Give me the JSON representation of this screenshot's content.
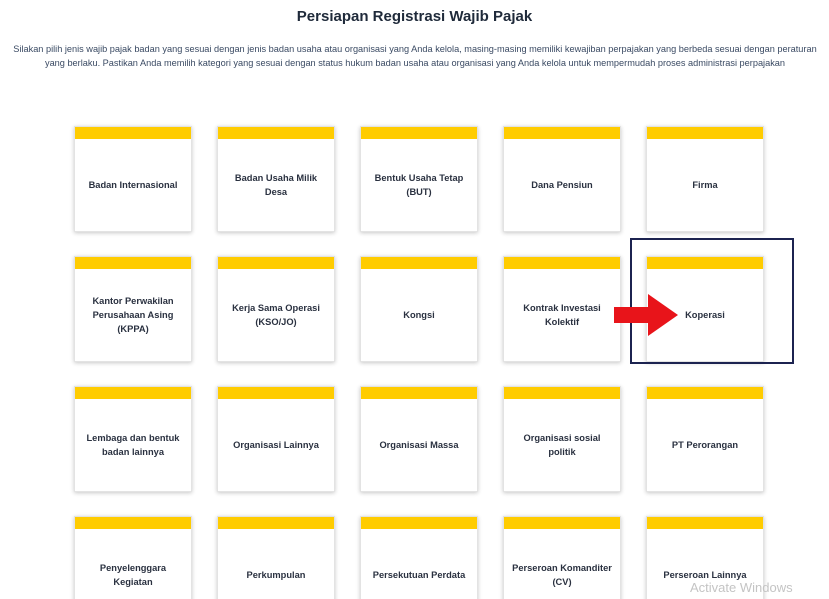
{
  "page": {
    "title": "Persiapan Registrasi Wajib Pajak",
    "description": "Silakan pilih jenis wajib pajak badan yang sesuai dengan jenis badan usaha atau organisasi yang Anda kelola, masing-masing memiliki kewajiban perpajakan yang berbeda sesuai dengan peraturan yang berlaku. Pastikan Anda memilih kategori yang sesuai dengan status hukum badan usaha atau organisasi yang Anda kelola untuk mempermudah proses administrasi perpajakan"
  },
  "cards": [
    {
      "label": "Badan Internasional"
    },
    {
      "label": "Badan Usaha Milik Desa"
    },
    {
      "label": "Bentuk Usaha Tetap (BUT)"
    },
    {
      "label": "Dana Pensiun"
    },
    {
      "label": "Firma"
    },
    {
      "label": "Kantor Perwakilan Perusahaan Asing (KPPA)"
    },
    {
      "label": "Kerja Sama Operasi (KSO/JO)"
    },
    {
      "label": "Kongsi"
    },
    {
      "label": "Kontrak Investasi Kolektif"
    },
    {
      "label": "Koperasi"
    },
    {
      "label": "Lembaga dan bentuk badan lainnya"
    },
    {
      "label": "Organisasi Lainnya"
    },
    {
      "label": "Organisasi Massa"
    },
    {
      "label": "Organisasi sosial politik"
    },
    {
      "label": "PT Perorangan"
    },
    {
      "label": "Penyelenggara Kegiatan"
    },
    {
      "label": "Perkumpulan"
    },
    {
      "label": "Persekutuan Perdata"
    },
    {
      "label": "Perseroan Komanditer (CV)"
    },
    {
      "label": "Perseroan Lainnya"
    }
  ],
  "colors": {
    "card_accent": "#ffcc00",
    "highlight_border": "#1c2350",
    "arrow": "#e8141a"
  },
  "watermark": "Activate Windows"
}
